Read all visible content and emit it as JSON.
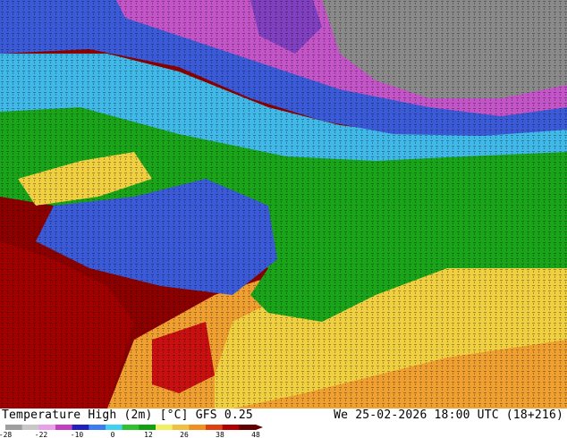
{
  "map": {
    "title": "Temperature High (2m) [°C] GFS 0.25",
    "datetime": "We 25-02-2026 18:00 UTC (18+216)"
  },
  "legend": {
    "ticks": [
      "-28",
      "-22",
      "-10",
      "0",
      "12",
      "26",
      "38",
      "48"
    ],
    "colors": [
      "#9e9e9e",
      "#c8c8c8",
      "#e8a0e8",
      "#c040c0",
      "#2020c0",
      "#3c7cf0",
      "#40d0f0",
      "#30c030",
      "#10a010",
      "#f0f060",
      "#f0c040",
      "#f09020",
      "#e04010",
      "#b00000",
      "#600000"
    ]
  },
  "regions": {
    "grey_north": "#8a8a8a",
    "magenta": "#c455c8",
    "purple": "#8040c0",
    "blue": "#3a5ad8",
    "cyan": "#40b8e8",
    "green": "#1aa41a",
    "yellow": "#f0d040",
    "orange": "#f0a030",
    "red": "#c81010",
    "darkred": "#8c0000"
  }
}
